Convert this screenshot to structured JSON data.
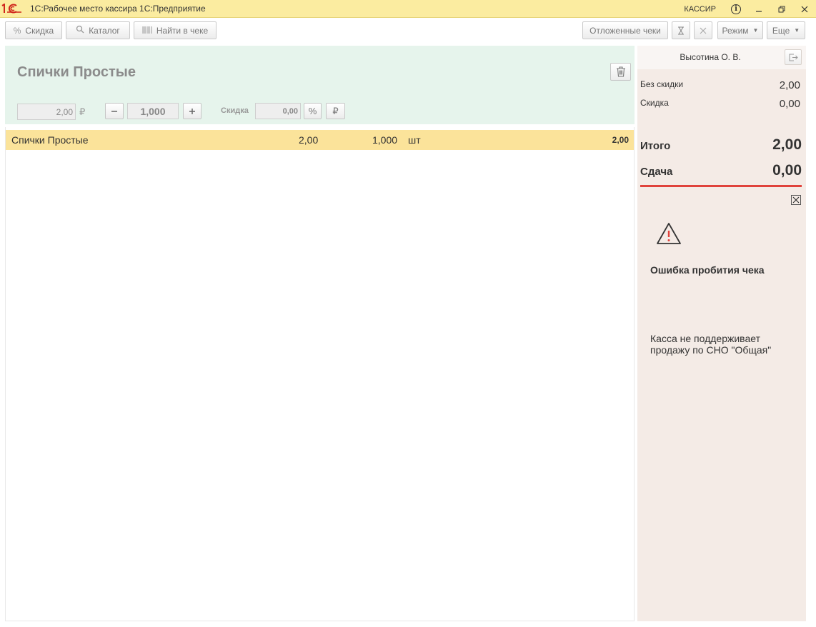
{
  "titlebar": {
    "app_title": "1С:Рабочее место кассира 1С:Предприятие",
    "user": "КАССИР"
  },
  "toolbar": {
    "discount": "Скидка",
    "catalog": "Каталог",
    "find_in_receipt": "Найти в чеке",
    "deferred_receipts": "Отложенные чеки",
    "mode": "Режим",
    "more": "Еще"
  },
  "item_panel": {
    "name": "Спички Простые",
    "price": "2,00",
    "currency": "₽",
    "quantity": "1,000",
    "discount_label": "Скидка",
    "discount_value": "0,00",
    "percent_symbol": "%",
    "ruble_symbol": "₽"
  },
  "receipt_lines": [
    {
      "name": "Спички Простые",
      "price": "2,00",
      "quantity": "1,000",
      "unit": "шт",
      "sum": "2,00"
    }
  ],
  "summary": {
    "cashier": "Высотина О. В.",
    "no_discount_label": "Без скидки",
    "no_discount_value": "2,00",
    "discount_label": "Скидка",
    "discount_value": "0,00",
    "total_label": "Итого",
    "total_value": "2,00",
    "change_label": "Сдача",
    "change_value": "0,00"
  },
  "error": {
    "title": "Ошибка пробития чека",
    "message": "Касса не поддерживает продажу по СНО \"Общая\""
  },
  "colors": {
    "titlebar_bg": "#fbeca0",
    "item_panel_bg": "#e6f4ec",
    "row_selected_bg": "#fbe39a",
    "right_panel_bg": "#f4ebe6",
    "accent_red": "#e0433c"
  }
}
